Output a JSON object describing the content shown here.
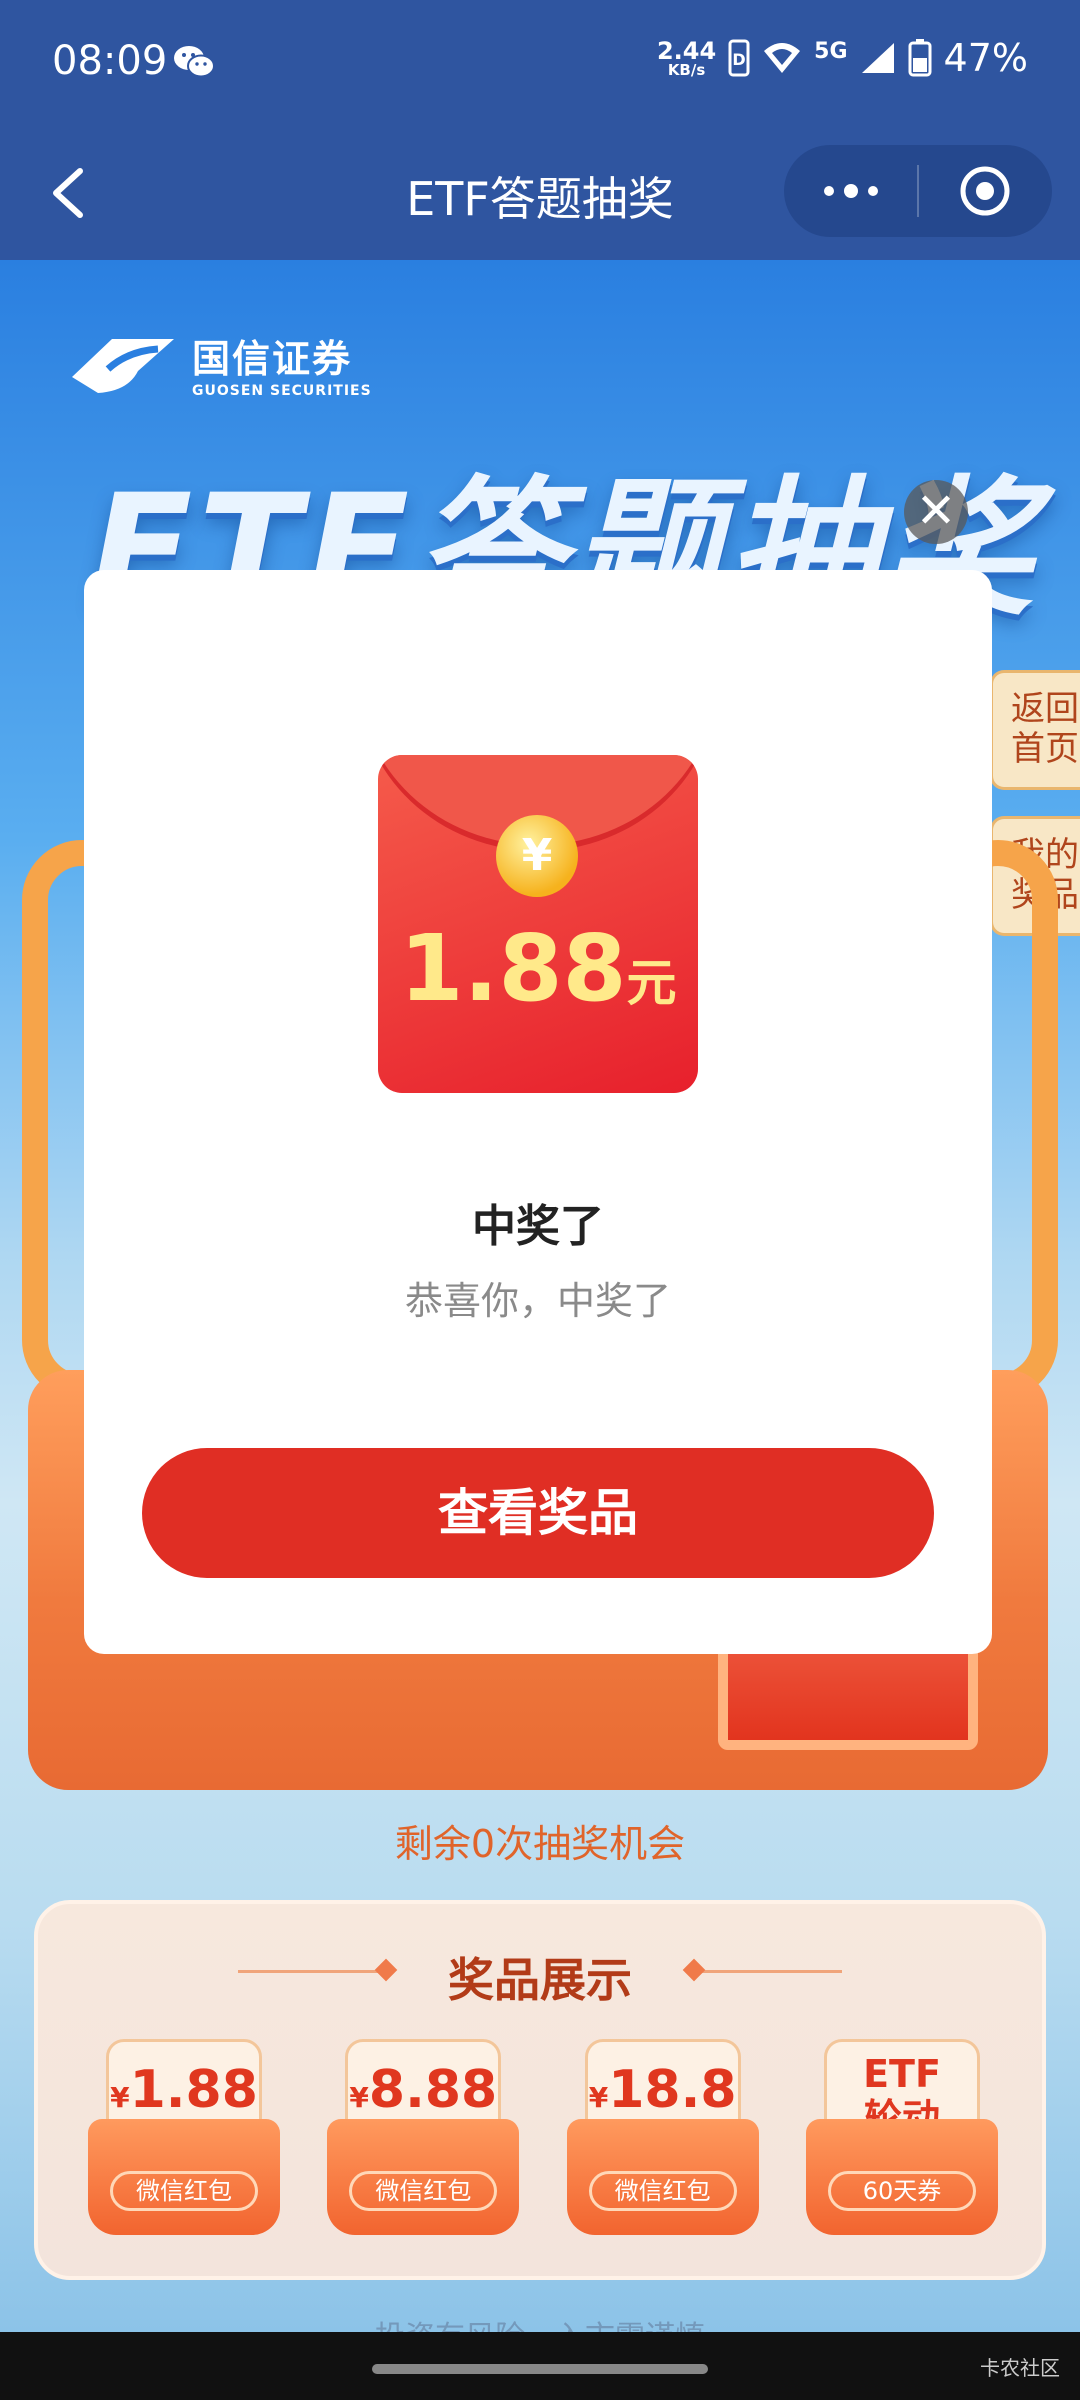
{
  "status_bar": {
    "time": "08:09",
    "net_speed": "2.44",
    "net_unit": "KB/s",
    "network": "5G",
    "battery": "47%"
  },
  "nav": {
    "title": "ETF答题抽奖"
  },
  "brand": {
    "name": "国信证券",
    "name_en": "GUOSEN SECURITIES"
  },
  "hero_title": "ETF答题抽奖",
  "side_tabs": {
    "home": "返回首页",
    "my_prizes": "我的奖品"
  },
  "modal": {
    "envelope_amount": "1.88",
    "envelope_unit": "元",
    "coin_symbol": "¥",
    "title": "中奖了",
    "subtitle": "恭喜你，中奖了",
    "button": "查看奖品",
    "close_symbol": "✕"
  },
  "remaining_text": "剩余0次抽奖机会",
  "prize_display": {
    "heading": "奖品展示",
    "cards": [
      {
        "currency": "¥",
        "amount": "1.88",
        "label": "微信红包"
      },
      {
        "currency": "¥",
        "amount": "8.88",
        "label": "微信红包"
      },
      {
        "currency": "¥",
        "amount": "18.8",
        "label": "微信红包"
      },
      {
        "line1": "ETF",
        "line2": "轮动",
        "label": "60天券"
      }
    ]
  },
  "disclaimer": "投资有风险，入市需谨慎",
  "watermark": "卡农社区",
  "colors": {
    "nav_bg": "#2f55a0",
    "accent_red": "#e02e24",
    "remaining_orange": "#e0642a"
  }
}
